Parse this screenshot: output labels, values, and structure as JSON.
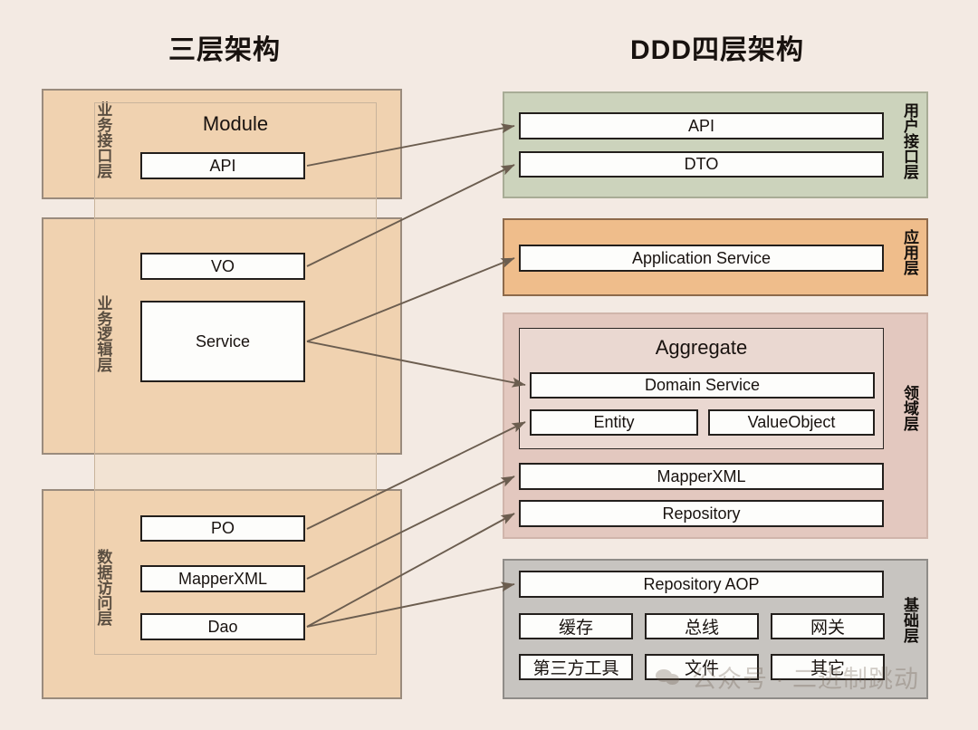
{
  "titles": {
    "left": "三层架构",
    "right": "DDD四层架构"
  },
  "left_architecture": {
    "container": {
      "label": "Module"
    },
    "layers": [
      {
        "name": "业务接口层",
        "items": [
          "API"
        ]
      },
      {
        "name": "业务逻辑层",
        "items": [
          "VO",
          "Service"
        ]
      },
      {
        "name": "数据访问层",
        "items": [
          "PO",
          "MapperXML",
          "Dao"
        ]
      }
    ],
    "boxes": {
      "api": "API",
      "vo": "VO",
      "service": "Service",
      "po": "PO",
      "mapperxml": "MapperXML",
      "dao": "Dao"
    },
    "layer_labels": {
      "interface": "业务接口层",
      "logic": "业务逻辑层",
      "data": "数据访问层"
    }
  },
  "ddd_architecture": {
    "layer_labels": {
      "user_interface": "用户接口层",
      "application": "应用层",
      "domain": "领域层",
      "infrastructure": "基础层"
    },
    "boxes": {
      "api": "API",
      "dto": "DTO",
      "application_service": "Application Service",
      "aggregate": "Aggregate",
      "domain_service": "Domain Service",
      "entity": "Entity",
      "value_object": "ValueObject",
      "mapperxml": "MapperXML",
      "repository": "Repository",
      "repository_aop": "Repository AOP",
      "cache": "缓存",
      "bus": "总线",
      "gateway": "网关",
      "third_party_tool": "第三方工具",
      "file": "文件",
      "other": "其它"
    }
  },
  "mappings": [
    {
      "from": "API",
      "to": "API"
    },
    {
      "from": "VO",
      "to": "DTO"
    },
    {
      "from": "Service",
      "to": "Application Service"
    },
    {
      "from": "Service",
      "to": "Domain Service"
    },
    {
      "from": "PO",
      "to": "Entity"
    },
    {
      "from": "MapperXML",
      "to": "MapperXML"
    },
    {
      "from": "Dao",
      "to": "Repository"
    },
    {
      "from": "Dao",
      "to": "Repository AOP"
    }
  ],
  "watermark": {
    "text": "公众号 · 二进制跳动",
    "icon": "wechat-icon"
  },
  "colors": {
    "background": "#f3eae3",
    "three_tier_band": "#f0d2b0",
    "user_interface_band": "#ccd3bc",
    "application_band": "#efbd8b",
    "domain_band": "#e3c8bf",
    "infrastructure_band": "#c7c4c0",
    "arrow": "#6b5d4f",
    "leaf_border": "#231f1c"
  }
}
